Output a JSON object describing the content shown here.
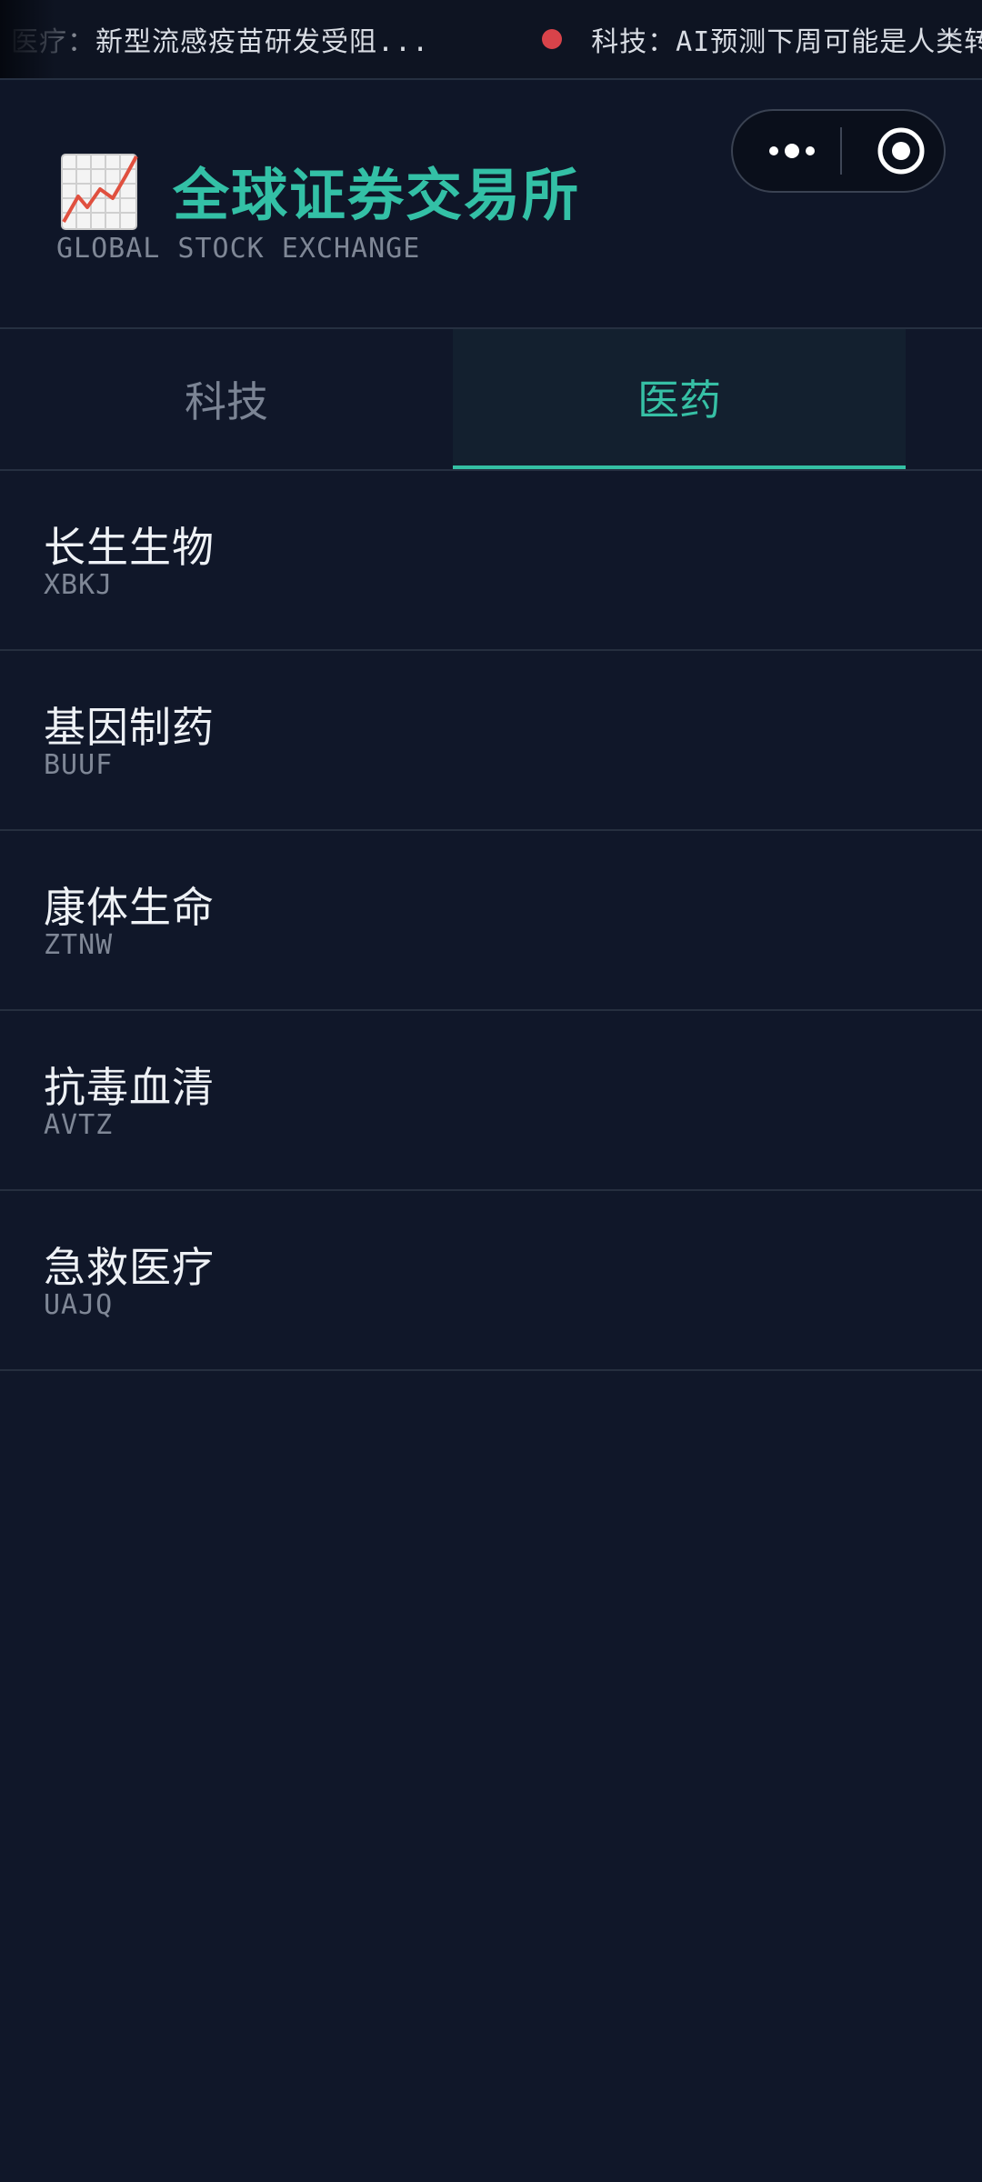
{
  "ticker": {
    "items": [
      "医疗：新型流感疫苗研发受阻...",
      "科技：AI预测下周可能是人类转折点"
    ],
    "dot_color": "#d8434a"
  },
  "header": {
    "icon": "chart-increasing-icon",
    "title": "全球证券交易所",
    "subtitle": "GLOBAL STOCK EXCHANGE"
  },
  "capsule": {
    "more_icon": "more-dots-icon",
    "close_icon": "close-target-icon"
  },
  "tabs": [
    {
      "label": "科技",
      "active": false
    },
    {
      "label": "医药",
      "active": true
    }
  ],
  "stocks": [
    {
      "name": "长生生物",
      "code": "XBKJ"
    },
    {
      "name": "基因制药",
      "code": "BUUF"
    },
    {
      "name": "康体生命",
      "code": "ZTNW"
    },
    {
      "name": "抗毒血清",
      "code": "AVTZ"
    },
    {
      "name": "急救医疗",
      "code": "UAJQ"
    }
  ],
  "colors": {
    "background": "#101729",
    "accent": "#34c0a4",
    "alert": "#d8434a"
  }
}
